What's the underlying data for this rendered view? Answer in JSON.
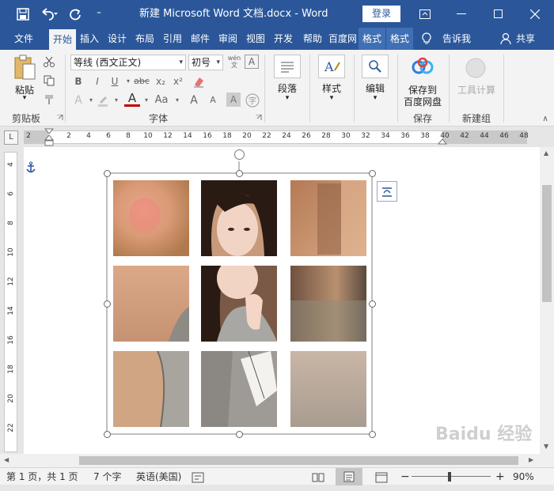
{
  "titlebar": {
    "title": "新建 Microsoft Word 文档.docx  -  Word",
    "login": "登录",
    "customize": "⁼"
  },
  "tabs": [
    {
      "label": "文件"
    },
    {
      "label": "开始"
    },
    {
      "label": "插入"
    },
    {
      "label": "设计"
    },
    {
      "label": "布局"
    },
    {
      "label": "引用"
    },
    {
      "label": "邮件"
    },
    {
      "label": "审阅"
    },
    {
      "label": "视图"
    },
    {
      "label": "开发"
    },
    {
      "label": "帮助"
    },
    {
      "label": "百度网"
    },
    {
      "label": "格式"
    },
    {
      "label": "格式"
    },
    {
      "label": "告诉我"
    },
    {
      "label": "共享"
    }
  ],
  "ribbon": {
    "clipboard": {
      "paste": "粘贴",
      "group": "剪贴板"
    },
    "font": {
      "name": "等线 (西文正文)",
      "size": "初号",
      "group": "字体",
      "bold": "B",
      "italic": "I",
      "underline": "U",
      "strike": "abc",
      "sub": "x₂",
      "sup": "x²",
      "effects": "A",
      "highlight": "ab",
      "color": "A",
      "case": "Aa",
      "grow": "A",
      "shrink": "A",
      "wen": "wén",
      "clear": "A"
    },
    "paragraph": {
      "label": "段落"
    },
    "styles": {
      "label": "样式"
    },
    "editing": {
      "label": "编辑"
    },
    "save": {
      "label1": "保存到",
      "label2": "百度网盘",
      "group": "保存"
    },
    "newgroup": {
      "label": "工具计算",
      "group": "新建组"
    }
  },
  "ruler": {
    "corner": "L",
    "h_numbers": [
      "2",
      "2",
      "4",
      "6",
      "8",
      "10",
      "12",
      "14",
      "16",
      "18",
      "20",
      "22",
      "24",
      "26",
      "28",
      "30",
      "32",
      "34",
      "36",
      "38",
      "40",
      "42",
      "44",
      "46",
      "48"
    ],
    "v_numbers": [
      "4",
      "6",
      "8",
      "10",
      "12",
      "14",
      "16",
      "18",
      "20",
      "22"
    ]
  },
  "status": {
    "page": "第 1 页，共 1 页",
    "words": "7 个字",
    "lang": "英语(美国)",
    "zoom": "90%"
  },
  "watermark": "Baidu 经验"
}
